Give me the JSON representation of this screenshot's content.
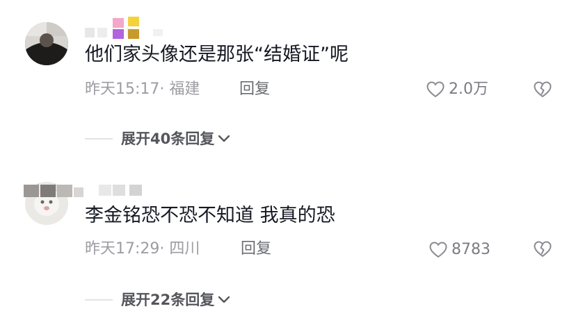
{
  "comments": [
    {
      "text": "他们家头像还是那张“结婚证”呢",
      "time": "昨天15:17",
      "location": "· 福建",
      "reply_label": "回复",
      "like_count": "2.0万",
      "expand_label": "展开40条回复",
      "avatar_icon": "user-avatar"
    },
    {
      "text": "李金铭恐不恐不知道 我真的恐",
      "time": "昨天17:29",
      "location": "· 四川",
      "reply_label": "回复",
      "like_count": "8783",
      "expand_label": "展开22条回复",
      "avatar_icon": "user-avatar"
    }
  ],
  "icons": {
    "like": "heart-outline-icon",
    "dislike": "broken-heart-icon",
    "expand": "chevron-down-icon"
  },
  "colors": {
    "text": "#161823",
    "meta": "#9c9ca2",
    "secondary": "#6b6c72"
  }
}
